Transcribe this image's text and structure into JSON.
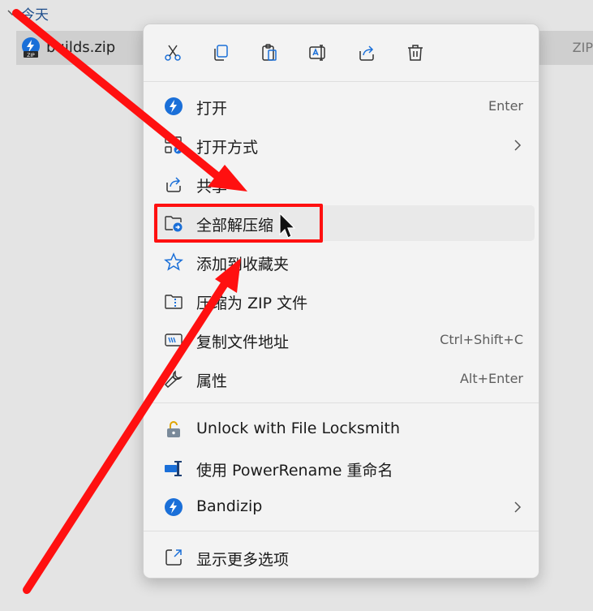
{
  "explorer": {
    "group_label": "今天",
    "file": {
      "name": "builds.zip",
      "type": "ZIP"
    }
  },
  "menu": {
    "toolbar": [
      {
        "name": "cut",
        "icon": "cut-icon"
      },
      {
        "name": "copy",
        "icon": "copy-icon"
      },
      {
        "name": "paste",
        "icon": "paste-icon"
      },
      {
        "name": "rename",
        "icon": "rename-icon"
      },
      {
        "name": "share",
        "icon": "share-icon"
      },
      {
        "name": "delete",
        "icon": "trash-icon"
      }
    ],
    "items": [
      {
        "label": "打开",
        "shortcut": "Enter",
        "icon": "bandizip-icon"
      },
      {
        "label": "打开方式",
        "submenu": true,
        "icon": "open-with-icon"
      },
      {
        "label": "共享",
        "icon": "share-icon"
      },
      {
        "label": "全部解压缩",
        "icon": "extract-folder-icon",
        "highlighted": true
      },
      {
        "label": "添加到收藏夹",
        "icon": "star-icon"
      },
      {
        "label": "压缩为 ZIP 文件",
        "icon": "zip-folder-icon"
      },
      {
        "label": "复制文件地址",
        "shortcut": "Ctrl+Shift+C",
        "icon": "copy-path-icon"
      },
      {
        "label": "属性",
        "shortcut": "Alt+Enter",
        "icon": "wrench-icon"
      }
    ],
    "extra_items": [
      {
        "label": "Unlock with File Locksmith",
        "icon": "lock-icon"
      },
      {
        "label": "使用 PowerRename 重命名",
        "icon": "powerrename-icon"
      },
      {
        "label": "Bandizip",
        "submenu": true,
        "icon": "bandizip-icon"
      }
    ],
    "more_options": {
      "label": "显示更多选项",
      "icon": "more-options-icon"
    }
  },
  "colors": {
    "accent": "#1a6fd8",
    "annotation": "#ff1010"
  }
}
